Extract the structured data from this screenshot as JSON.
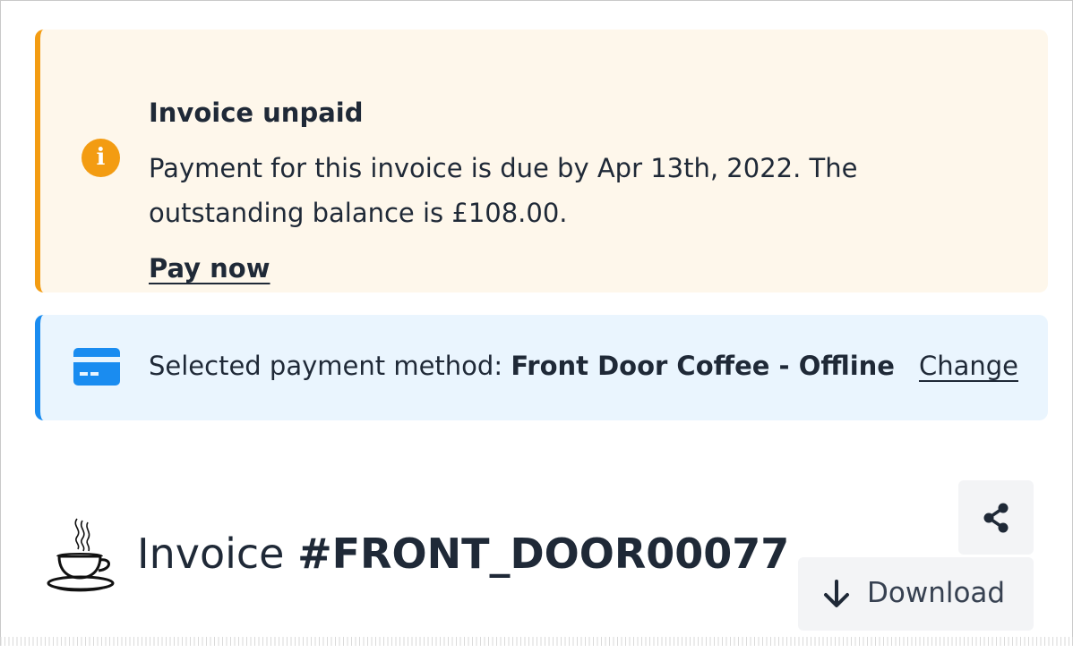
{
  "warning_alert": {
    "icon": "info-icon",
    "icon_glyph": "i",
    "title": "Invoice unpaid",
    "message": "Payment for this invoice is due by Apr 13th, 2022. The outstanding balance is £108.00.",
    "pay_link": "Pay now",
    "accent_color": "#f39c12",
    "background_color": "#fef7eb"
  },
  "payment_alert": {
    "icon": "credit-card-icon",
    "label": "Selected payment method:",
    "method": "Front Door Coffee - Offline",
    "change_link": "Change",
    "accent_color": "#1a8cf0",
    "background_color": "#eaf5fe"
  },
  "invoice": {
    "logo": "coffee-cup-logo",
    "title_prefix": "Invoice",
    "number": "#FRONT_DOOR00077"
  },
  "actions": {
    "share_icon": "share-icon",
    "download_icon": "arrow-down-icon",
    "download_label": "Download"
  }
}
